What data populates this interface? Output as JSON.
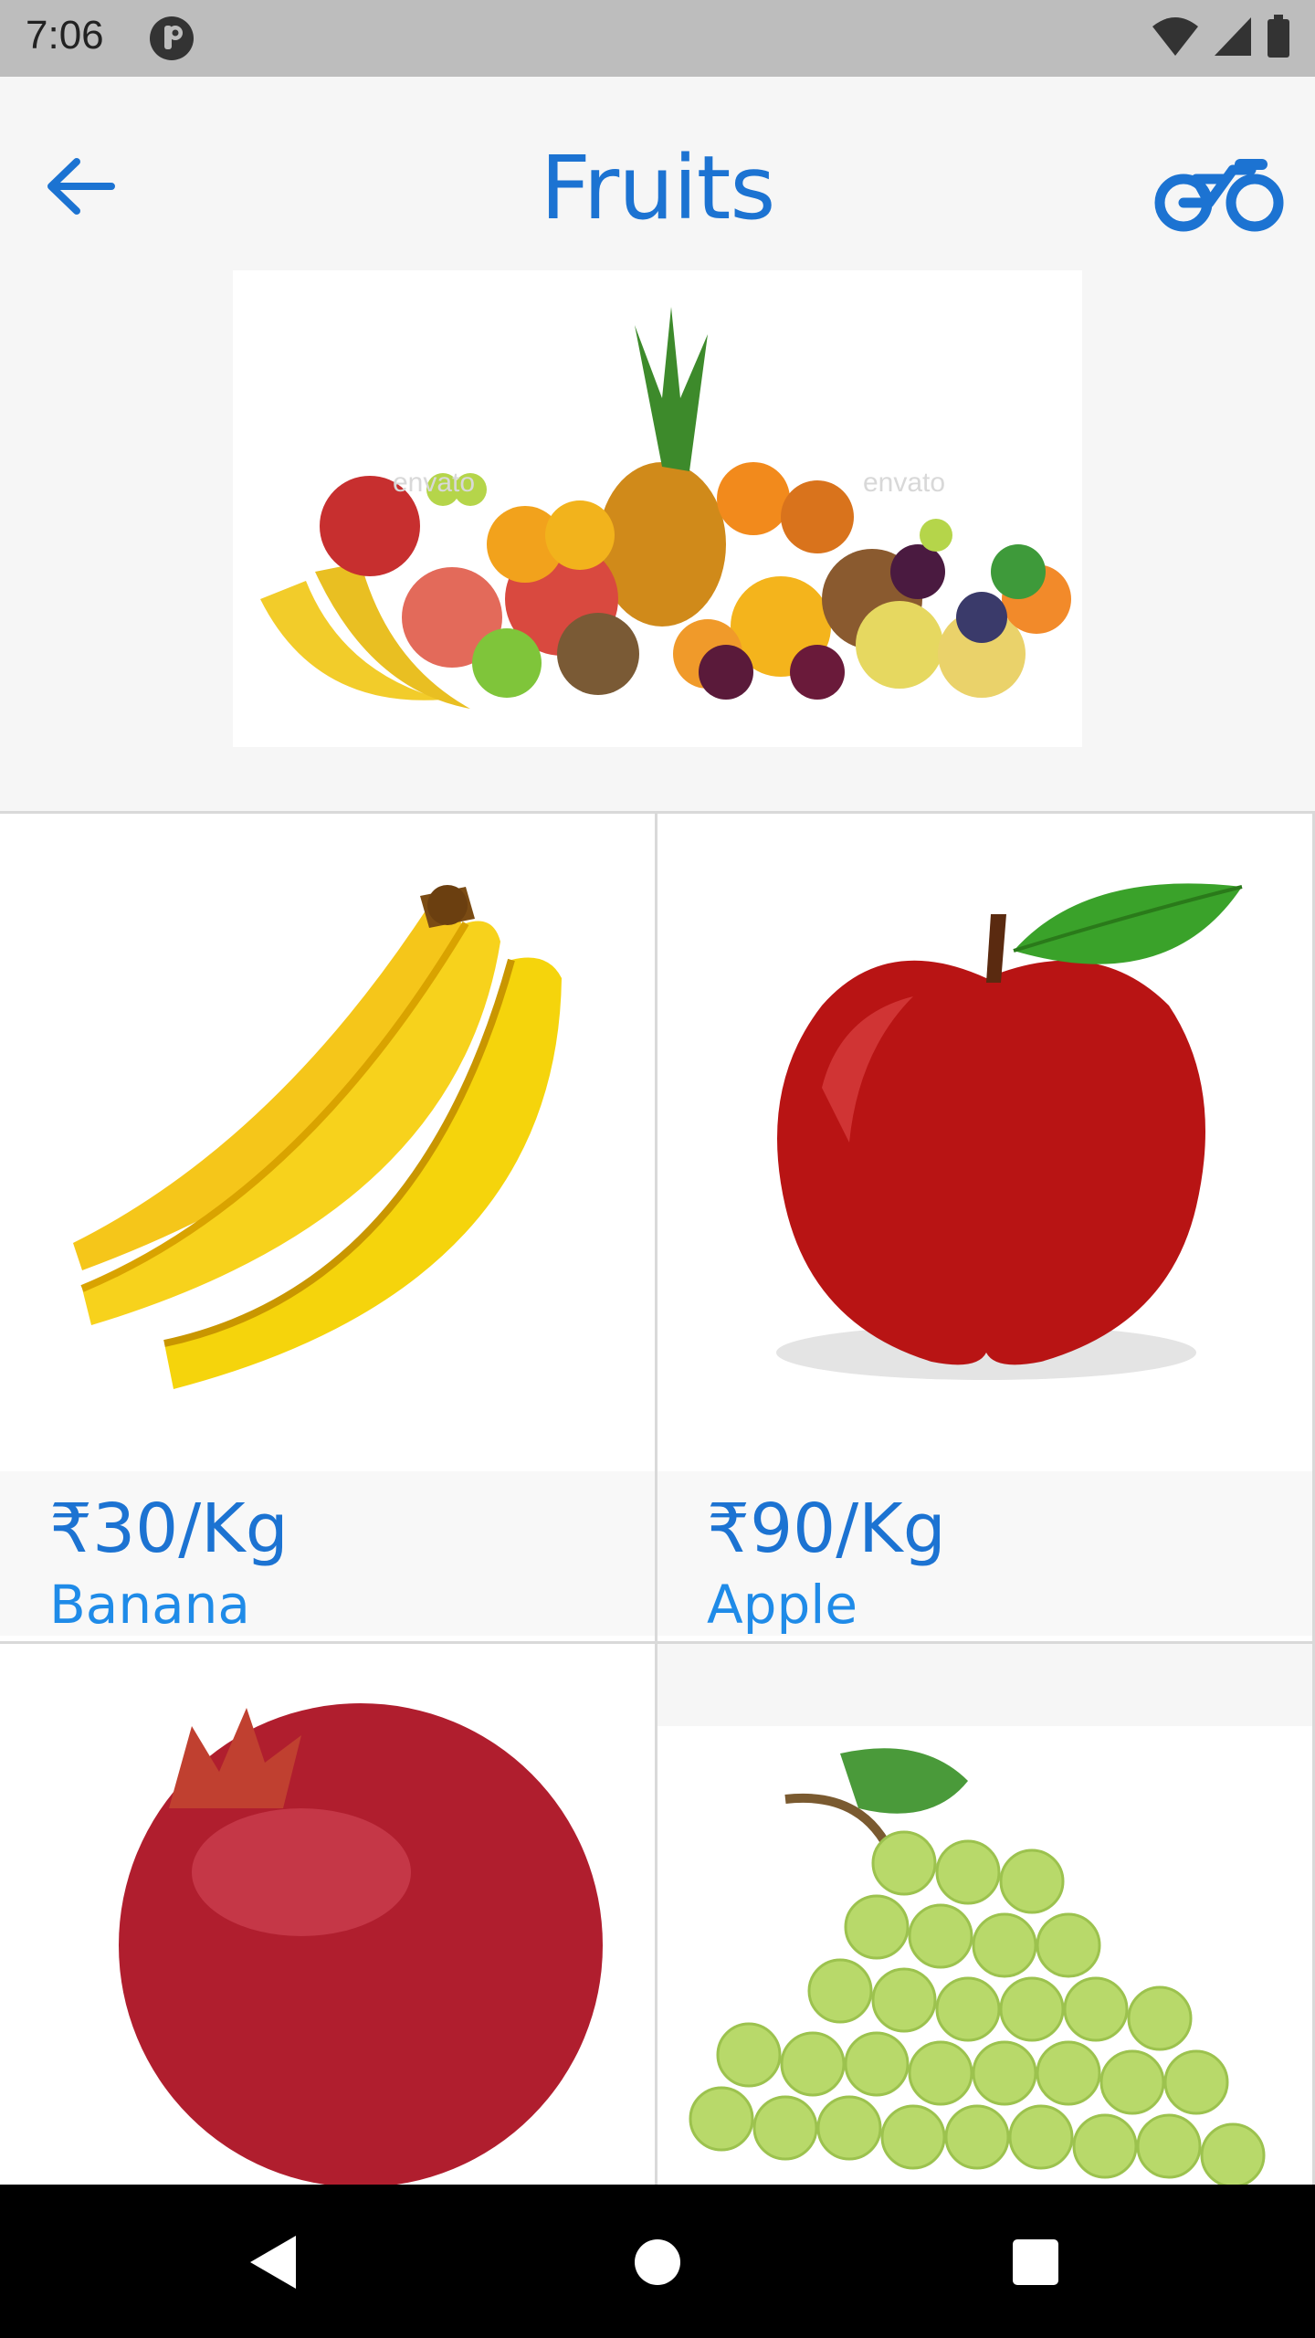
{
  "status_bar": {
    "time": "7:06",
    "icons": [
      "app-notification-icon",
      "wifi-icon",
      "signal-icon",
      "battery-icon"
    ]
  },
  "toolbar": {
    "title": "Fruits",
    "back_icon": "arrow-left-icon",
    "action_icon": "bicycle-icon",
    "accent_color": "#1c73d2"
  },
  "banner": {
    "icon": "mixed-fruits-image",
    "watermark": "envato"
  },
  "products": [
    {
      "name": "Banana",
      "price": "₹30/Kg",
      "icon": "banana-image"
    },
    {
      "name": "Apple",
      "price": "₹90/Kg",
      "icon": "apple-image"
    },
    {
      "name": "",
      "price": "",
      "icon": "pomegranate-image"
    },
    {
      "name": "",
      "price": "",
      "icon": "grapes-image"
    }
  ],
  "nav_bar": {
    "back": "back-triangle-icon",
    "home": "home-circle-icon",
    "recents": "recents-square-icon"
  }
}
